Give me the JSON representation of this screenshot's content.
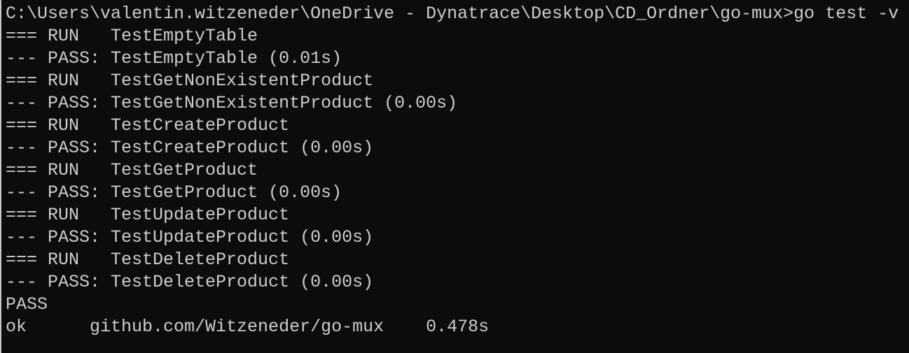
{
  "terminal": {
    "lines": [
      "C:\\Users\\valentin.witzeneder\\OneDrive - Dynatrace\\Desktop\\CD_Ordner\\go-mux>go test -v",
      "=== RUN   TestEmptyTable",
      "--- PASS: TestEmptyTable (0.01s)",
      "=== RUN   TestGetNonExistentProduct",
      "--- PASS: TestGetNonExistentProduct (0.00s)",
      "=== RUN   TestCreateProduct",
      "--- PASS: TestCreateProduct (0.00s)",
      "=== RUN   TestGetProduct",
      "--- PASS: TestGetProduct (0.00s)",
      "=== RUN   TestUpdateProduct",
      "--- PASS: TestUpdateProduct (0.00s)",
      "=== RUN   TestDeleteProduct",
      "--- PASS: TestDeleteProduct (0.00s)",
      "PASS",
      "ok      github.com/Witzeneder/go-mux    0.478s"
    ],
    "colors": {
      "background": "#0c0c0c",
      "text": "#cccccc"
    }
  }
}
